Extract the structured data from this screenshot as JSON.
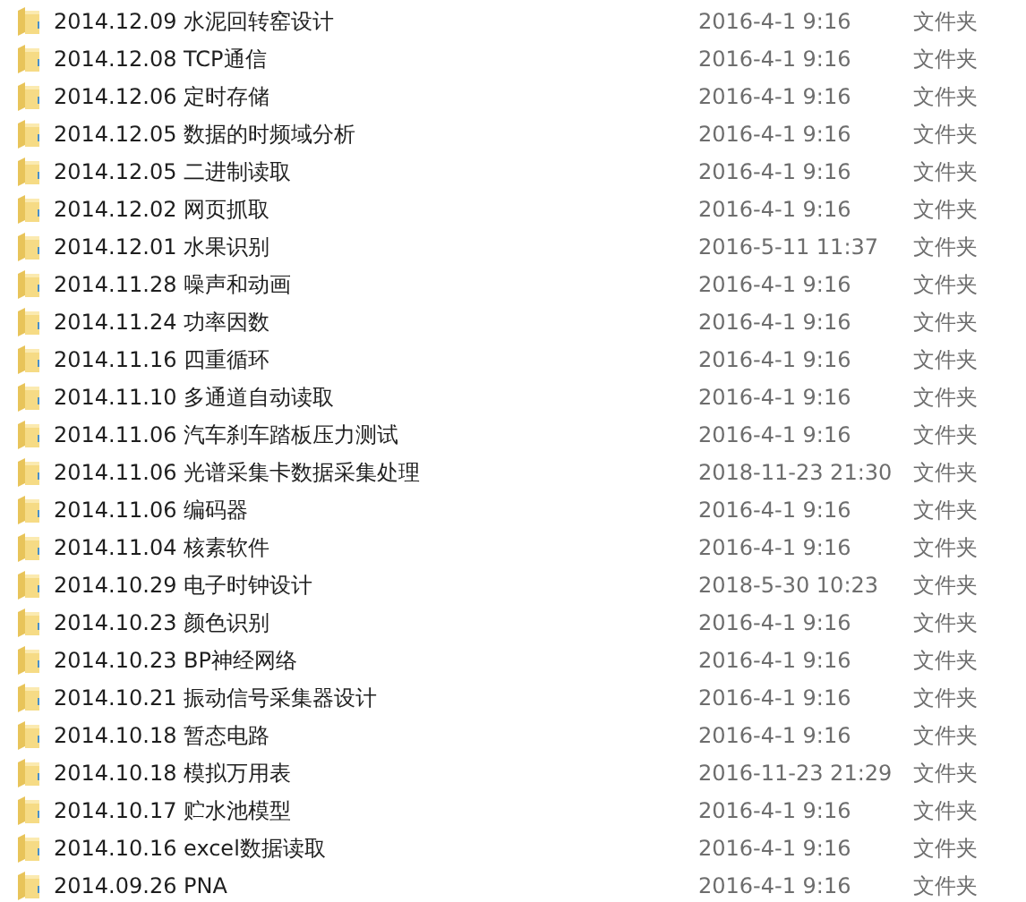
{
  "files": [
    {
      "name": "2014.12.09 水泥回转窑设计",
      "modified": "2016-4-1 9:16",
      "type": "文件夹"
    },
    {
      "name": "2014.12.08 TCP通信",
      "modified": "2016-4-1 9:16",
      "type": "文件夹"
    },
    {
      "name": "2014.12.06 定时存储",
      "modified": "2016-4-1 9:16",
      "type": "文件夹"
    },
    {
      "name": "2014.12.05 数据的时频域分析",
      "modified": "2016-4-1 9:16",
      "type": "文件夹"
    },
    {
      "name": "2014.12.05 二进制读取",
      "modified": "2016-4-1 9:16",
      "type": "文件夹"
    },
    {
      "name": "2014.12.02 网页抓取",
      "modified": "2016-4-1 9:16",
      "type": "文件夹"
    },
    {
      "name": "2014.12.01 水果识别",
      "modified": "2016-5-11 11:37",
      "type": "文件夹"
    },
    {
      "name": "2014.11.28 噪声和动画",
      "modified": "2016-4-1 9:16",
      "type": "文件夹"
    },
    {
      "name": "2014.11.24 功率因数",
      "modified": "2016-4-1 9:16",
      "type": "文件夹"
    },
    {
      "name": "2014.11.16 四重循环",
      "modified": "2016-4-1 9:16",
      "type": "文件夹"
    },
    {
      "name": "2014.11.10 多通道自动读取",
      "modified": "2016-4-1 9:16",
      "type": "文件夹"
    },
    {
      "name": "2014.11.06 汽车刹车踏板压力测试",
      "modified": "2016-4-1 9:16",
      "type": "文件夹"
    },
    {
      "name": "2014.11.06 光谱采集卡数据采集处理",
      "modified": "2018-11-23 21:30",
      "type": "文件夹"
    },
    {
      "name": "2014.11.06 编码器",
      "modified": "2016-4-1 9:16",
      "type": "文件夹"
    },
    {
      "name": "2014.11.04 核素软件",
      "modified": "2016-4-1 9:16",
      "type": "文件夹"
    },
    {
      "name": "2014.10.29 电子时钟设计",
      "modified": "2018-5-30 10:23",
      "type": "文件夹"
    },
    {
      "name": "2014.10.23 颜色识别",
      "modified": "2016-4-1 9:16",
      "type": "文件夹"
    },
    {
      "name": "2014.10.23 BP神经网络",
      "modified": "2016-4-1 9:16",
      "type": "文件夹"
    },
    {
      "name": "2014.10.21 振动信号采集器设计",
      "modified": "2016-4-1 9:16",
      "type": "文件夹"
    },
    {
      "name": "2014.10.18 暂态电路",
      "modified": "2016-4-1 9:16",
      "type": "文件夹"
    },
    {
      "name": "2014.10.18 模拟万用表",
      "modified": "2016-11-23 21:29",
      "type": "文件夹"
    },
    {
      "name": "2014.10.17 贮水池模型",
      "modified": "2016-4-1 9:16",
      "type": "文件夹"
    },
    {
      "name": "2014.10.16 excel数据读取",
      "modified": "2016-4-1 9:16",
      "type": "文件夹"
    },
    {
      "name": "2014.09.26 PNA",
      "modified": "2016-4-1 9:16",
      "type": "文件夹"
    }
  ]
}
